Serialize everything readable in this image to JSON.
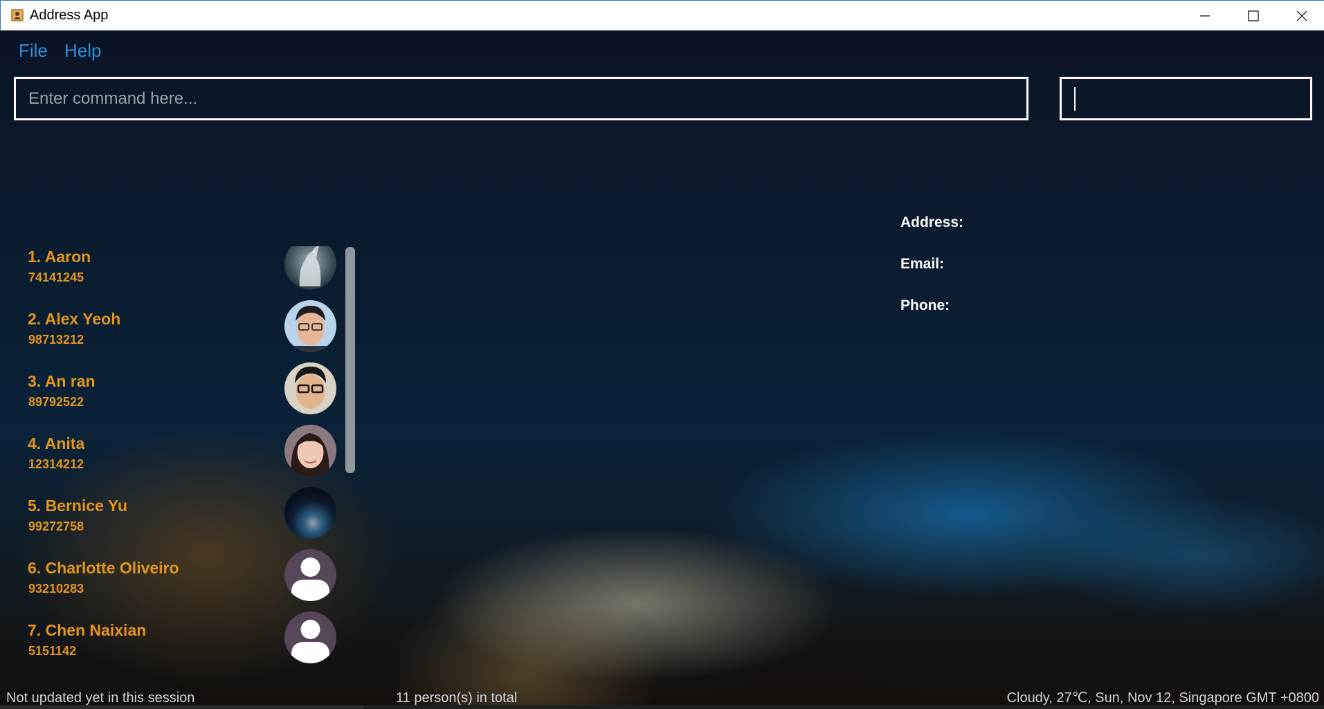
{
  "window": {
    "title": "Address App",
    "controls": [
      "minimize",
      "maximize",
      "close"
    ]
  },
  "menu": {
    "items": [
      {
        "label": "File"
      },
      {
        "label": "Help"
      }
    ]
  },
  "command": {
    "placeholder": "Enter command here...",
    "value": ""
  },
  "result": {
    "text": ""
  },
  "persons": [
    {
      "index": "1.",
      "name": "Aaron",
      "phone": "74141245",
      "avatar": "photo-horse"
    },
    {
      "index": "2.",
      "name": "Alex Yeoh",
      "phone": "98713212",
      "avatar": "photo-man-glasses"
    },
    {
      "index": "3.",
      "name": "An ran",
      "phone": "89792522",
      "avatar": "photo-man-glasses-2"
    },
    {
      "index": "4.",
      "name": "Anita",
      "phone": "12314212",
      "avatar": "photo-woman"
    },
    {
      "index": "5.",
      "name": "Bernice Yu",
      "phone": "99272758",
      "avatar": "photo-night-sky"
    },
    {
      "index": "6.",
      "name": "Charlotte Oliveiro",
      "phone": "93210283",
      "avatar": "default-user-icon"
    },
    {
      "index": "7.",
      "name": "Chen Naixian",
      "phone": "5151142",
      "avatar": "default-user-icon"
    }
  ],
  "details": {
    "address_label": "Address:",
    "email_label": "Email:",
    "phone_label": "Phone:"
  },
  "status": {
    "sync": "Not updated yet in this session",
    "total": "11 person(s) in total",
    "weather": "Cloudy, 27℃, Sun, Nov 12, Singapore GMT +0800"
  },
  "colors": {
    "menu": "#2f8fd8",
    "person_text": "#e3961e",
    "detail_label": "#ffffff"
  }
}
